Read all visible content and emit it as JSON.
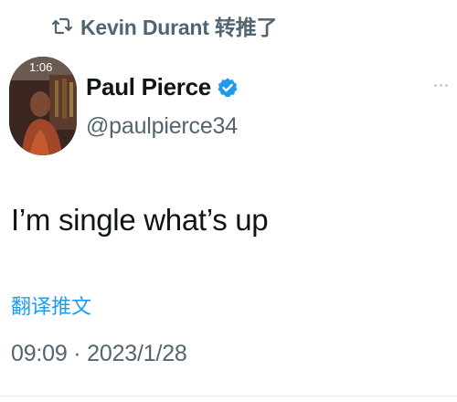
{
  "retweet": {
    "icon": "retweet-icon",
    "text": "Kevin Durant 转推了"
  },
  "author": {
    "avatar_clock": "1:06",
    "display_name": "Paul Pierce",
    "verified_icon": "verified-badge-icon",
    "verified_color": "#1d9bf0",
    "handle": "@paulpierce34"
  },
  "more_icon": "more-options-icon",
  "tweet": {
    "text": "I’m single what’s up",
    "translate_label": "翻译推文",
    "timestamp": "09:09 · 2023/1/28"
  },
  "colors": {
    "text": "#0f1419",
    "secondary": "#536471",
    "link": "#1d9bf0"
  }
}
